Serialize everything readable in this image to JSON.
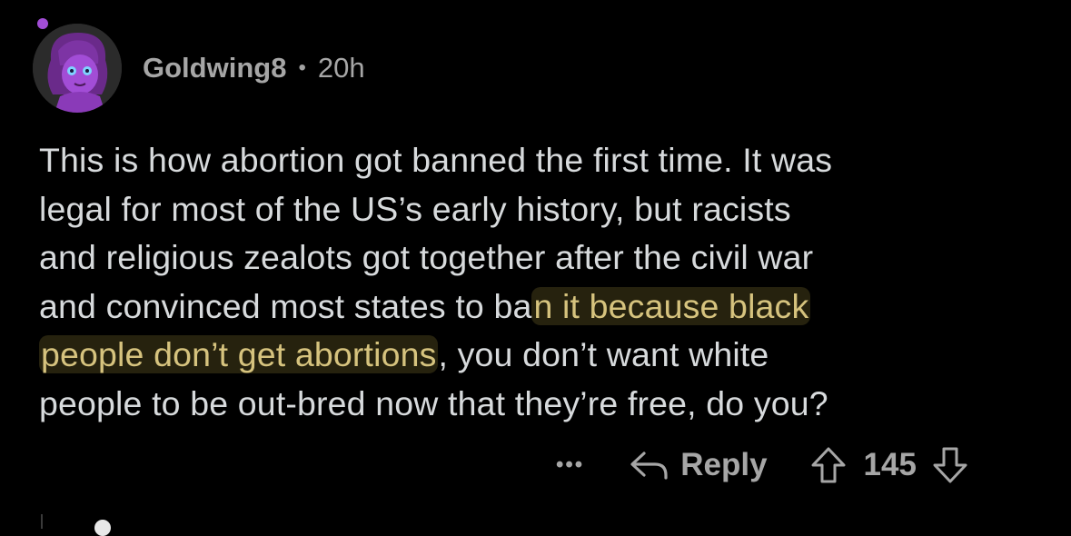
{
  "comment": {
    "username": "Goldwing8",
    "separator": "•",
    "timestamp": "20h",
    "body_lines": [
      "This is how abortion got banned the first time. It was",
      "legal for most of the US’s early history, but racists",
      "and religious zealots got together after the civil war"
    ],
    "line4_normal": "and convinced most states to ba",
    "line4_highlight": "n it because black",
    "line5_highlight": "people don’t get abortions",
    "line5_normal": ", you don’t want white",
    "line6": "people to be out-bred now that they’re free, do you?",
    "actions": {
      "more": "•••",
      "reply_label": "Reply",
      "score": "145"
    }
  },
  "icons": {
    "online_dot": "online-status-dot",
    "reply": "reply-arrow-icon",
    "upvote": "upvote-arrow-icon",
    "downvote": "downvote-arrow-icon"
  },
  "colors": {
    "background": "#000000",
    "text": "#d7dadc",
    "meta": "#a6a6a6",
    "highlight_text": "#d6c37e",
    "accent_purple": "#a24dd6"
  }
}
